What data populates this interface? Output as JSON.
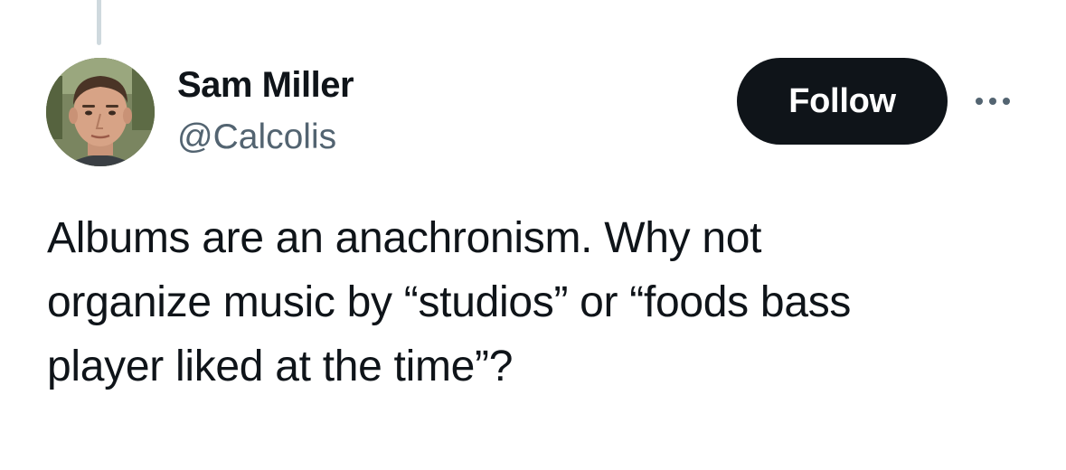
{
  "author": {
    "display_name": "Sam Miller",
    "handle": "@Calcolis",
    "avatar_icon": "profile-photo"
  },
  "actions": {
    "follow_label": "Follow",
    "more_icon": "more-horizontal-icon"
  },
  "tweet": {
    "text": "Albums are an anachronism. Why not\norganize music by “studios” or “foods bass\nplayer liked at the time”?"
  },
  "colors": {
    "primary_text": "#0f1419",
    "secondary_text": "#536471",
    "button_bg": "#0f1419",
    "button_text": "#ffffff",
    "thread_line": "#cfd9de"
  }
}
